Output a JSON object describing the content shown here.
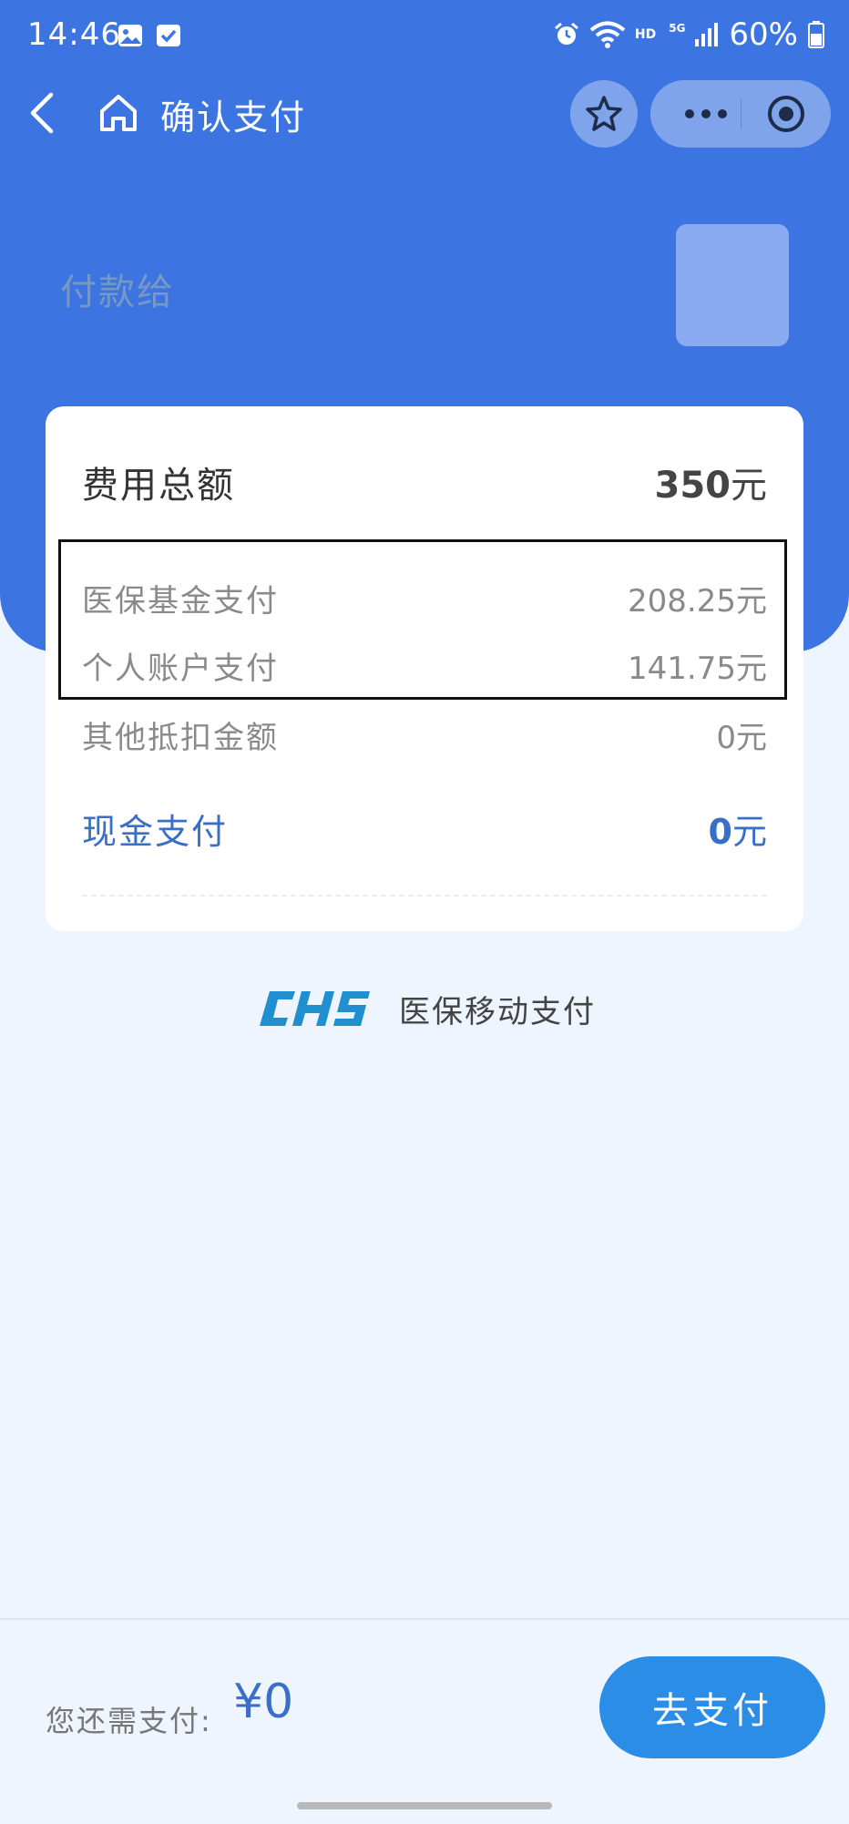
{
  "status_bar": {
    "time": "14:46",
    "network_hd": "HD",
    "network_5g": "5G",
    "battery": "60%"
  },
  "nav": {
    "title": "确认支付"
  },
  "payee": {
    "label": "付款给"
  },
  "summary": {
    "total_label": "费用总额",
    "total_value": "350",
    "currency_unit": "元",
    "rows": [
      {
        "label": "医保基金支付",
        "value": "208.25元"
      },
      {
        "label": "个人账户支付",
        "value": "141.75元"
      },
      {
        "label": "其他抵扣金额",
        "value": "0元"
      }
    ],
    "cash_label": "现金支付",
    "cash_value": "0",
    "cash_unit": "元"
  },
  "brand": {
    "logo_text": "CHS",
    "text": "医保移动支付"
  },
  "footer": {
    "due_label": "您还需支付:",
    "due_amount": "¥0",
    "pay_button": "去支付"
  },
  "colors": {
    "header_blue": "#3c74e2",
    "accent_blue": "#3a6fc8",
    "button_blue": "#2b8de6",
    "page_bg": "#eef5fe",
    "chs_logo": "#1f8fd0"
  }
}
